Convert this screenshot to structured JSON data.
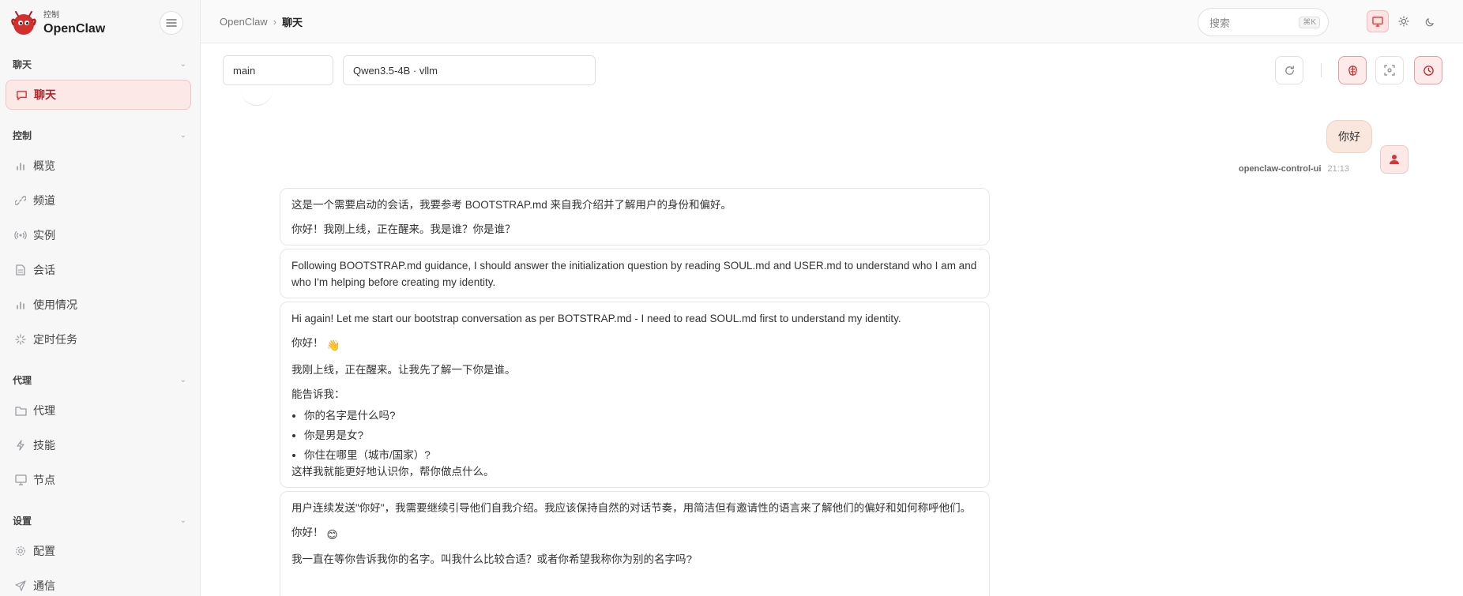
{
  "brand": {
    "subtitle": "控制",
    "name": "OpenClaw"
  },
  "sidebar": {
    "sections": [
      {
        "label": "聊天"
      },
      {
        "label": "控制"
      },
      {
        "label": "代理"
      },
      {
        "label": "设置"
      }
    ],
    "items": [
      {
        "label": "聊天",
        "icon": "chat-bubble-icon",
        "active": true
      },
      {
        "label": "概览",
        "icon": "bar-chart-icon"
      },
      {
        "label": "频道",
        "icon": "link-icon"
      },
      {
        "label": "实例",
        "icon": "broadcast-icon"
      },
      {
        "label": "会话",
        "icon": "document-icon"
      },
      {
        "label": "使用情况",
        "icon": "bar-chart-icon"
      },
      {
        "label": "定时任务",
        "icon": "loader-icon"
      },
      {
        "label": "代理",
        "icon": "folder-icon"
      },
      {
        "label": "技能",
        "icon": "lightning-icon"
      },
      {
        "label": "节点",
        "icon": "monitor-icon"
      },
      {
        "label": "配置",
        "icon": "gear-icon"
      },
      {
        "label": "通信",
        "icon": "send-icon"
      }
    ]
  },
  "topbar": {
    "breadcrumb": {
      "root": "OpenClaw",
      "separator": "›",
      "current": "聊天"
    },
    "search": {
      "placeholder": "搜索",
      "shortcut": "⌘K"
    }
  },
  "controls": {
    "session_value": "main",
    "model_value": "Qwen3.5-4B · vllm"
  },
  "chat": {
    "user_message": {
      "text": "你好",
      "sender": "openclaw-control-ui",
      "time": "21:13"
    },
    "assistant_messages": [
      {
        "paragraphs": [
          "这是一个需要启动的会话，我要参考 BOOTSTRAP.md 来自我介绍并了解用户的身份和偏好。",
          "你好！我刚上线，正在醒来。我是谁？你是谁？"
        ]
      },
      {
        "paragraphs": [
          "Following BOOTSTRAP.md guidance, I should answer the initialization question by reading SOUL.md and USER.md to understand who I am and who I'm helping before creating my identity."
        ]
      },
      {
        "intro": "Hi again! Let me start our bootstrap conversation as per BOTSTRAP.md - I need to read SOUL.md first to understand my identity.",
        "greeting": "你好！",
        "line1": "我刚上线，正在醒来。让我先了解一下你是谁。",
        "line2": "能告诉我：",
        "bullets": [
          "你的名字是什么吗?",
          "你是男是女?",
          "你住在哪里（城市/国家）?"
        ],
        "outro": "这样我就能更好地认识你，帮你做点什么。"
      },
      {
        "intro": "用户连续发送\"你好\"，我需要继续引导他们自我介绍。我应该保持自然的对话节奏，用简洁但有邀请性的语言来了解他们的偏好和如何称呼他们。",
        "greeting": "你好！",
        "line1": "我一直在等你告诉我你的名字。叫我什么比较合适？或者你希望我称你为别的名字吗?"
      }
    ]
  },
  "colors": {
    "accent": "#d32f2f",
    "active_bg": "#fde8e8",
    "user_bubble": "#f9e6dc"
  }
}
